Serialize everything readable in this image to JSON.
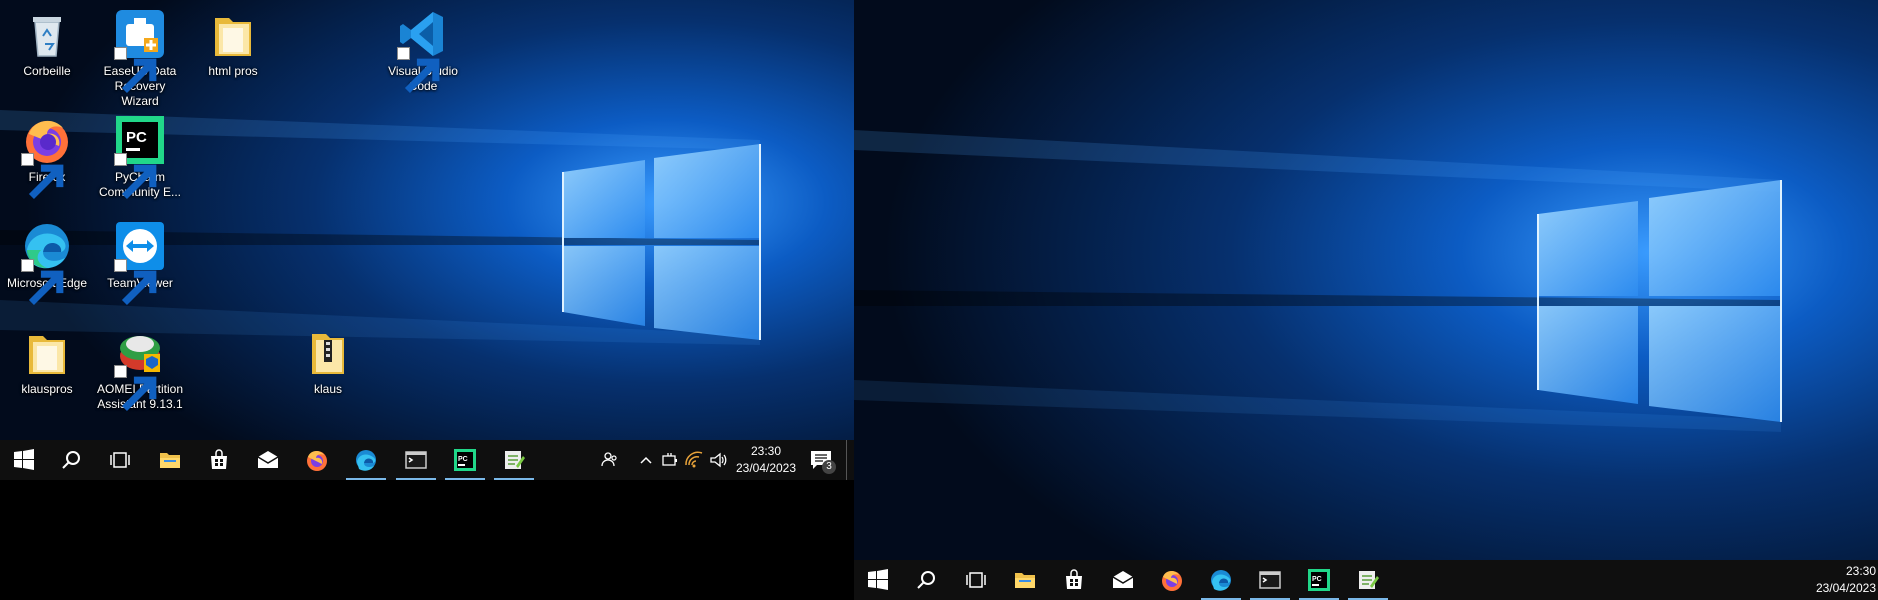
{
  "monitors": [
    {
      "id": "left",
      "desktop_icons": [
        {
          "label": "Corbeille",
          "icon": "recycle-bin-icon"
        },
        {
          "label": "EaseUS Data Recovery Wizard",
          "icon": "easeus-icon"
        },
        {
          "label": "html pros",
          "icon": "folder-icon"
        },
        {
          "label": "Visual Studio Code",
          "icon": "vscode-icon"
        },
        {
          "label": "Firefox",
          "icon": "firefox-icon"
        },
        {
          "label": "PyCharm Community E...",
          "icon": "pycharm-icon"
        },
        {
          "label": "Microsoft Edge",
          "icon": "edge-icon"
        },
        {
          "label": "TeamViewer",
          "icon": "teamviewer-icon"
        },
        {
          "label": "klauspros",
          "icon": "folder-icon"
        },
        {
          "label": "AOMEI Partition Assistant 9.13.1",
          "icon": "aomei-icon"
        },
        {
          "label": "klaus",
          "icon": "folder-zip-icon"
        }
      ]
    }
  ],
  "taskbar": {
    "pinned": [
      {
        "name": "start",
        "icon": "windows-logo-icon"
      },
      {
        "name": "search",
        "icon": "search-icon"
      },
      {
        "name": "task-view",
        "icon": "task-view-icon"
      },
      {
        "name": "file-explorer",
        "icon": "file-explorer-icon"
      },
      {
        "name": "store",
        "icon": "store-icon"
      },
      {
        "name": "mail",
        "icon": "mail-icon"
      },
      {
        "name": "firefox",
        "icon": "firefox-icon"
      },
      {
        "name": "edge",
        "icon": "edge-icon",
        "active": true
      },
      {
        "name": "terminal",
        "icon": "terminal-icon",
        "active": true
      },
      {
        "name": "pycharm",
        "icon": "pycharm-icon",
        "active": true
      },
      {
        "name": "notepad-plus",
        "icon": "notepad-plus-icon",
        "active": true
      }
    ],
    "tray": [
      "people-icon",
      "chevron-up-icon",
      "battery-plug-icon",
      "wifi-icon",
      "volume-icon"
    ],
    "clock": {
      "time": "23:30",
      "date": "23/04/2023"
    },
    "notifications": {
      "count": "3"
    }
  },
  "colors": {
    "wallpaper_dark": "#04122a",
    "wallpaper_glow": "#2a8cff",
    "taskbar": "#0f0f0f",
    "active_indicator": "#7ab8e8"
  }
}
